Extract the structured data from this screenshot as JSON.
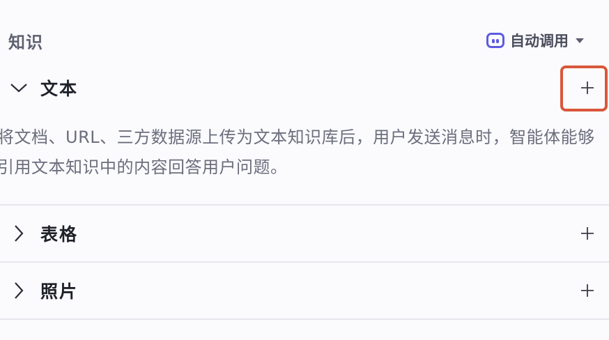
{
  "header": {
    "title": "知识",
    "auto_call_label": "自动调用",
    "auto_call_icon": "robot-icon",
    "accent_color": "#5b5ce0"
  },
  "groups": [
    {
      "label": "文本",
      "expanded": true,
      "chevron": "chevron-down-icon",
      "add_icon": "plus-icon"
    },
    {
      "label": "表格",
      "expanded": false,
      "chevron": "chevron-right-icon",
      "add_icon": "plus-icon"
    },
    {
      "label": "照片",
      "expanded": false,
      "chevron": "chevron-right-icon",
      "add_icon": "plus-icon"
    }
  ],
  "text_description": "将文档、URL、三方数据源上传为文本知识库后，用户发送消息时，智能体能够引用文本知识中的内容回答用户问题。",
  "highlight_color": "#d9573a"
}
